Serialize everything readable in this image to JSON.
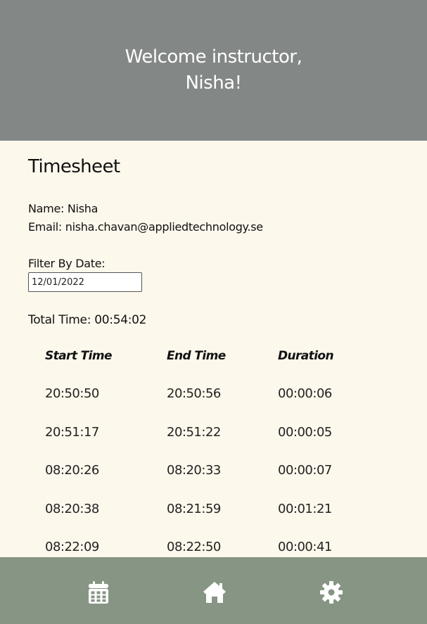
{
  "header": {
    "welcome_line1": "Welcome instructor,",
    "welcome_line2": "Nisha!"
  },
  "timesheet": {
    "title": "Timesheet",
    "name_line": "Name: Nisha",
    "email_line": "Email: nisha.chavan@appliedtechnology.se",
    "filter_label": "Filter By Date:",
    "filter_value": "12/01/2022",
    "total_time": "Total Time: 00:54:02",
    "columns": [
      "Start Time",
      "End Time",
      "Duration"
    ],
    "rows": [
      [
        "20:50:50",
        "20:50:56",
        "00:00:06"
      ],
      [
        "20:51:17",
        "20:51:22",
        "00:00:05"
      ],
      [
        "08:20:26",
        "08:20:33",
        "00:00:07"
      ],
      [
        "08:20:38",
        "08:21:59",
        "00:01:21"
      ],
      [
        "08:22:09",
        "08:22:50",
        "00:00:41"
      ]
    ]
  },
  "nav": {
    "items": [
      {
        "icon": "calendar-icon"
      },
      {
        "icon": "home-icon"
      },
      {
        "icon": "gear-icon"
      }
    ]
  },
  "colors": {
    "header_bg": "#838886",
    "page_bg": "#fdf8ec",
    "nav_bg": "#879584",
    "icon": "#ffffff"
  }
}
